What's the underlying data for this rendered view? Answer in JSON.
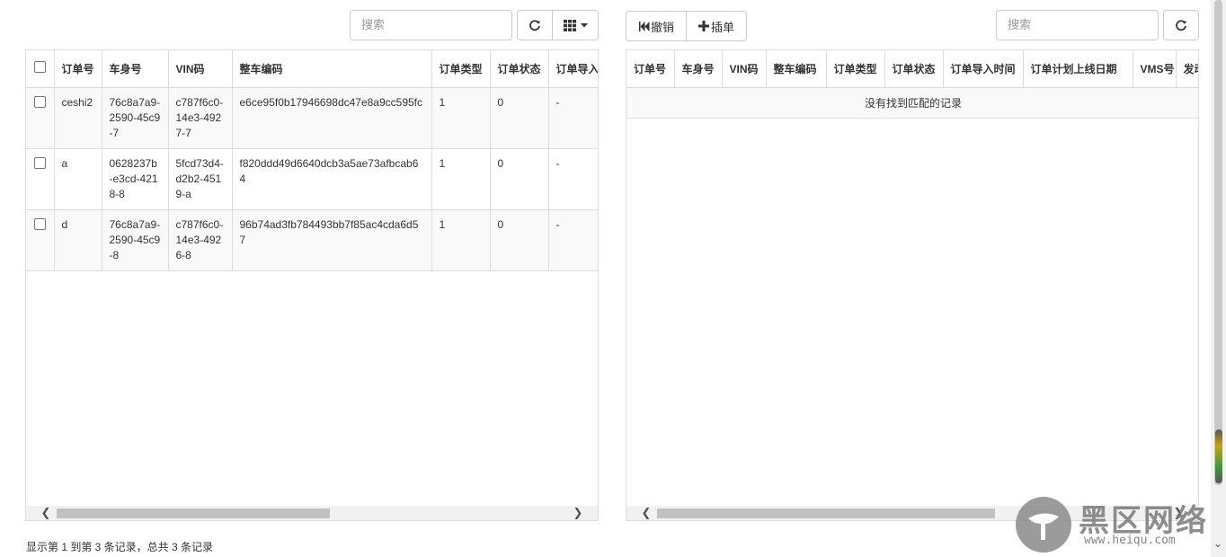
{
  "left": {
    "search_placeholder": "搜索",
    "columns": [
      "订单号",
      "车身号",
      "VIN码",
      "整车编码",
      "订单类型",
      "订单状态",
      "订单导入"
    ],
    "rows": [
      [
        "ceshi2",
        "76c8a7a9-2590-45c9-7",
        "c787f6c0-14e3-4927-7",
        "e6ce95f0b17946698dc47e8a9cc595fc",
        "1",
        "0",
        "-"
      ],
      [
        "a",
        "0628237b-e3cd-4218-8",
        "5fcd73d4-d2b2-4519-a",
        "f820ddd49d6640dcb3a5ae73afbcab64",
        "1",
        "0",
        "-"
      ],
      [
        "d",
        "76c8a7a9-2590-45c9-8",
        "c787f6c0-14e3-4926-8",
        "96b74ad3fb784493bb7f85ac4cda6d57",
        "1",
        "0",
        "-"
      ]
    ],
    "pagination_info": "显示第 1 到第 3 条记录，总共 3 条记录"
  },
  "right": {
    "undo_label": "撤销",
    "insert_label": "插单",
    "search_placeholder": "搜索",
    "columns": [
      "订单号",
      "车身号",
      "VIN码",
      "整车编码",
      "订单类型",
      "订单状态",
      "订单导入时间",
      "订单计划上线日期",
      "VMS号",
      "发动"
    ],
    "empty_message": "没有找到匹配的记录"
  },
  "watermark": {
    "brand": "黑区网络",
    "url": "www.heiqu.com"
  }
}
